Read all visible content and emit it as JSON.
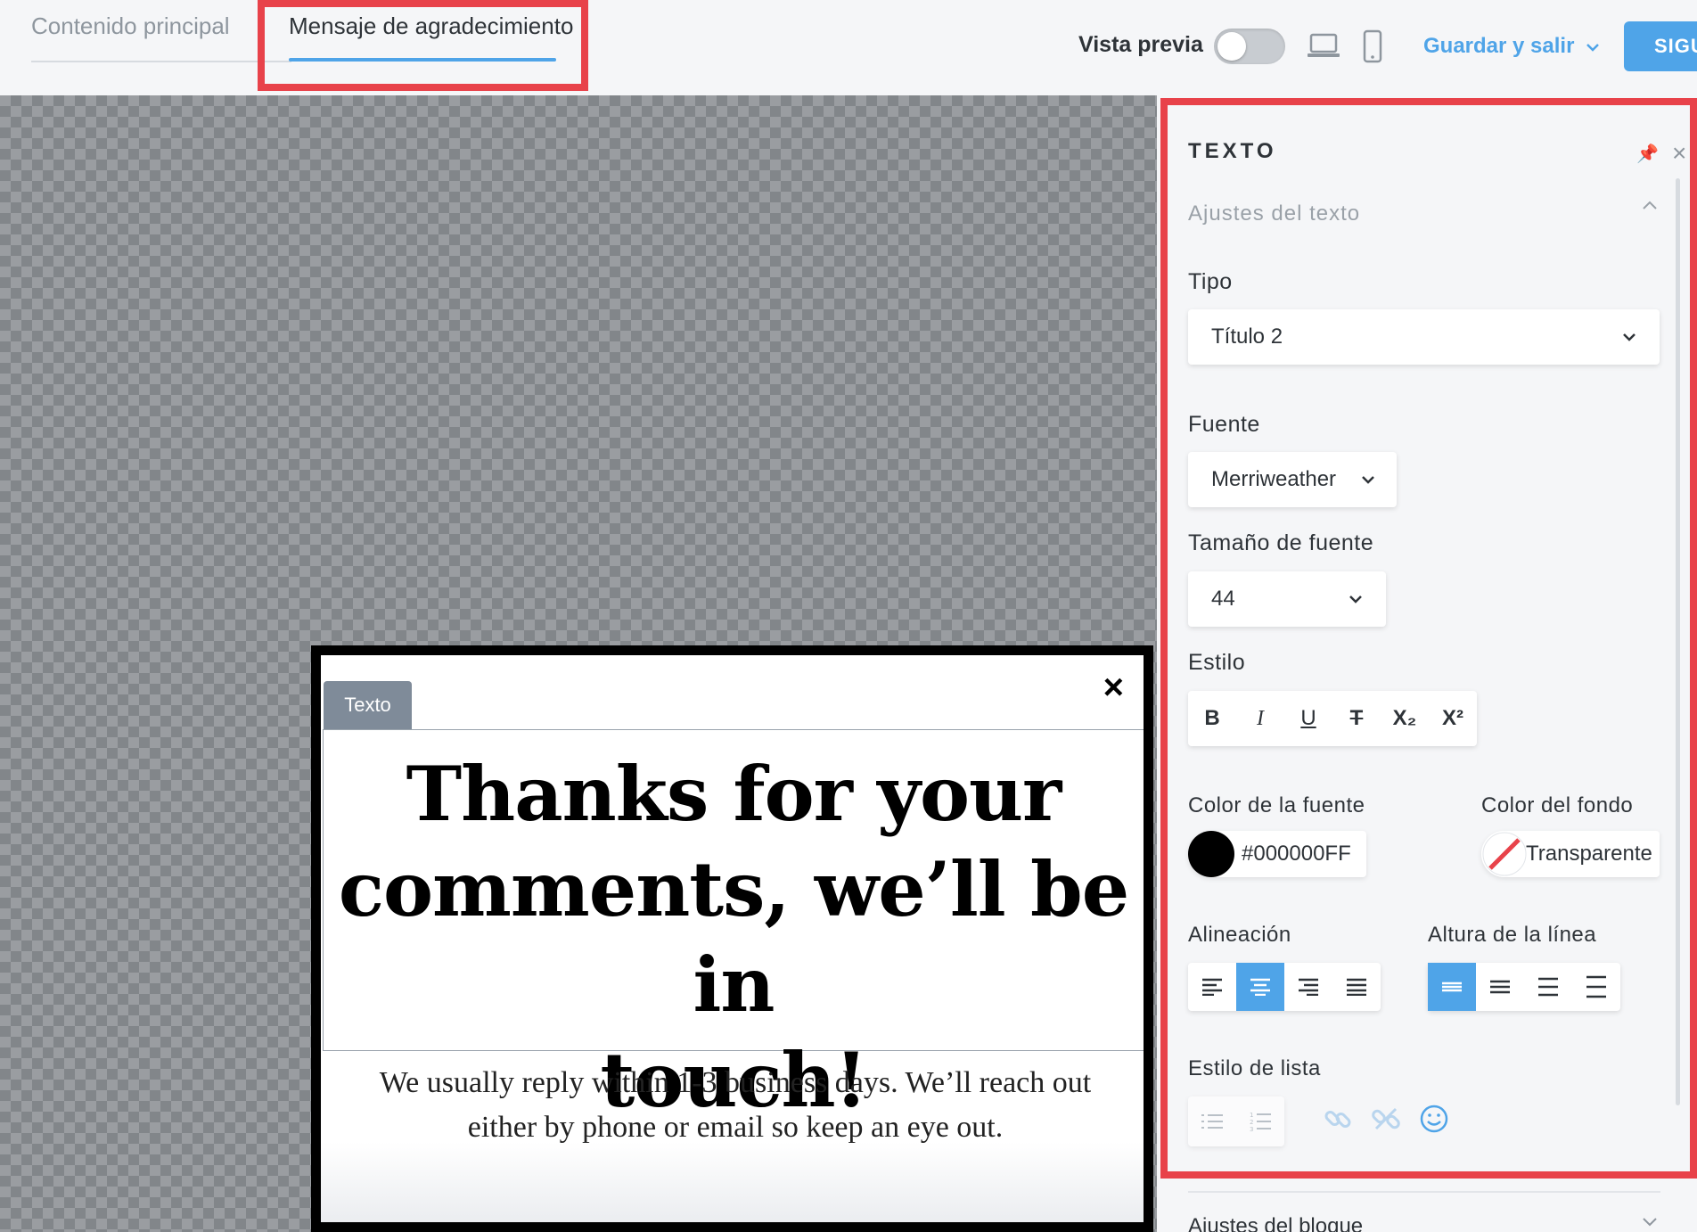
{
  "tabs": {
    "main_content": "Contenido principal",
    "thank_you": "Mensaje de agradecimiento"
  },
  "toolbar": {
    "preview_label": "Vista previa",
    "save_exit": "Guardar y salir",
    "next": "SIGU"
  },
  "popup": {
    "tag": "Texto",
    "close": "×",
    "heading_line1": "Thanks for your",
    "heading_line2": "comments, we’ll be in",
    "heading_line3": "touch!",
    "body_line1": "We usually reply within 1-3 business days. We’ll reach out",
    "body_line2": "either by phone or email so keep an eye out."
  },
  "panel": {
    "title": "TEXTO",
    "section_title": "Ajustes del texto",
    "type_label": "Tipo",
    "type_value": "Título 2",
    "font_label": "Fuente",
    "font_value": "Merriweather",
    "font_size_label": "Tamaño de fuente",
    "font_size_value": "44",
    "style_label": "Estilo",
    "style_buttons": [
      "B",
      "I",
      "U",
      "T",
      "X₂",
      "X²"
    ],
    "font_color_label": "Color de la fuente",
    "font_color_value": "#000000FF",
    "bg_color_label": "Color del fondo",
    "bg_color_value": "Transparente",
    "align_label": "Alineación",
    "line_height_label": "Altura de la línea",
    "list_style_label": "Estilo de lista",
    "block_settings_label": "Ajustes del bloque"
  },
  "colors": {
    "accent": "#4fa4e8",
    "highlight": "#e8424a",
    "font_color": "#000000"
  },
  "icons": [
    "laptop-icon",
    "mobile-icon",
    "chevron-down-icon",
    "pin-icon",
    "close-icon",
    "chevron-up-icon",
    "link-icon",
    "unlink-icon",
    "emoji-icon"
  ]
}
